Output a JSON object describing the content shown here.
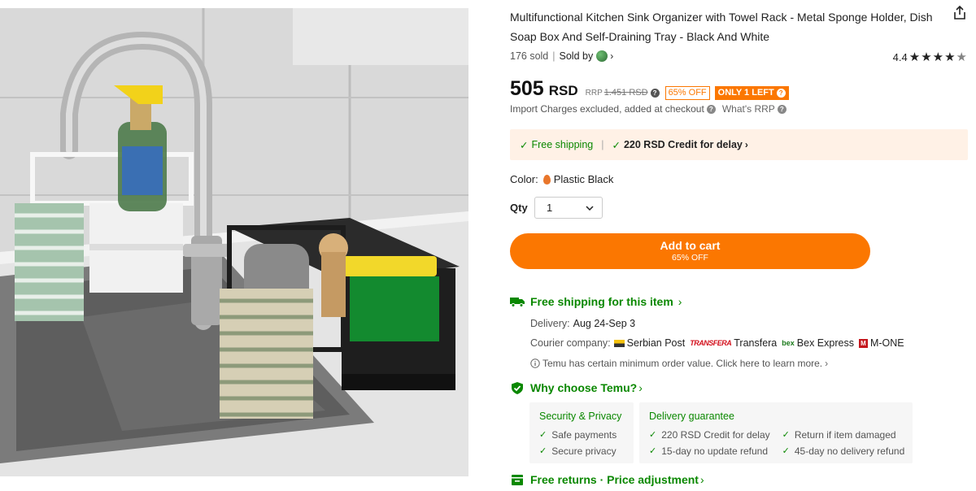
{
  "product": {
    "title": "Multifunctional Kitchen Sink Organizer with Towel Rack - Metal Sponge Holder, Dish Soap Box And Self-Draining Tray - Black And White",
    "sold": "176 sold",
    "sold_by": "Sold by",
    "rating_value": "4.4",
    "rating_stars": 4.4
  },
  "price": {
    "amount": "505",
    "currency": "RSD",
    "rrp_label": "RRP",
    "rrp_value": "1.451 RSD",
    "discount_badge": "65% OFF",
    "stock_badge": "ONLY 1 LEFT",
    "import_note": "Import Charges excluded, added at checkout",
    "whats_rrp": "What's RRP"
  },
  "shipping_banner": {
    "free_shipping": "Free shipping",
    "credit": "220 RSD Credit for delay"
  },
  "options": {
    "color_label": "Color:",
    "color_value": "Plastic Black",
    "qty_label": "Qty",
    "qty_value": "1"
  },
  "cart": {
    "label": "Add to cart",
    "sub": "65% OFF"
  },
  "shipping_section": {
    "title": "Free shipping for this item",
    "delivery_label": "Delivery:",
    "delivery_value": "Aug 24-Sep 3",
    "courier_label": "Courier company:",
    "couriers": [
      "Serbian Post",
      "Transfera",
      "Bex Express",
      "M-ONE"
    ],
    "min_order_note": "Temu has certain minimum order value. Click here to learn more."
  },
  "why_temu": {
    "title": "Why choose Temu?",
    "security": {
      "title": "Security & Privacy",
      "items": [
        "Safe payments",
        "Secure privacy"
      ]
    },
    "delivery": {
      "title": "Delivery guarantee",
      "items": [
        "220 RSD Credit for delay",
        "15-day no update refund",
        "Return if item damaged",
        "45-day no delivery refund"
      ]
    }
  },
  "returns": {
    "title": "Free returns · Price adjustment"
  },
  "colors": {
    "accent": "#fb7701",
    "green": "#0a8800",
    "banner_bg": "#fff1e6"
  },
  "icons": [
    "share-icon",
    "star-icon",
    "question-icon",
    "check-icon",
    "truck-icon",
    "shield-check-icon",
    "info-icon",
    "return-box-icon",
    "chevron-down-icon",
    "chevron-right-icon"
  ]
}
